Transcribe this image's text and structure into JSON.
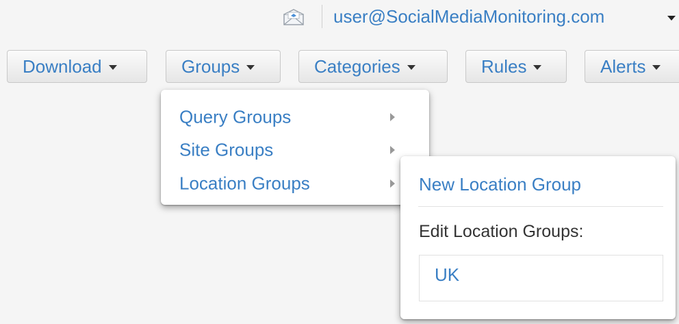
{
  "header": {
    "mail_icon": "envelope-icon",
    "user_email": "user@SocialMediaMonitoring.com"
  },
  "toolbar": {
    "buttons": [
      {
        "label": "Download"
      },
      {
        "label": "Groups"
      },
      {
        "label": "Categories"
      },
      {
        "label": "Rules"
      },
      {
        "label": "Alerts"
      }
    ]
  },
  "groups_menu": {
    "items": [
      {
        "label": "Query Groups"
      },
      {
        "label": "Site Groups"
      },
      {
        "label": "Location Groups"
      }
    ]
  },
  "location_submenu": {
    "new_label": "New Location Group",
    "edit_heading": "Edit Location Groups:",
    "groups": [
      "UK"
    ]
  },
  "colors": {
    "link": "#3a7fc4",
    "background": "#f5f5f5"
  }
}
